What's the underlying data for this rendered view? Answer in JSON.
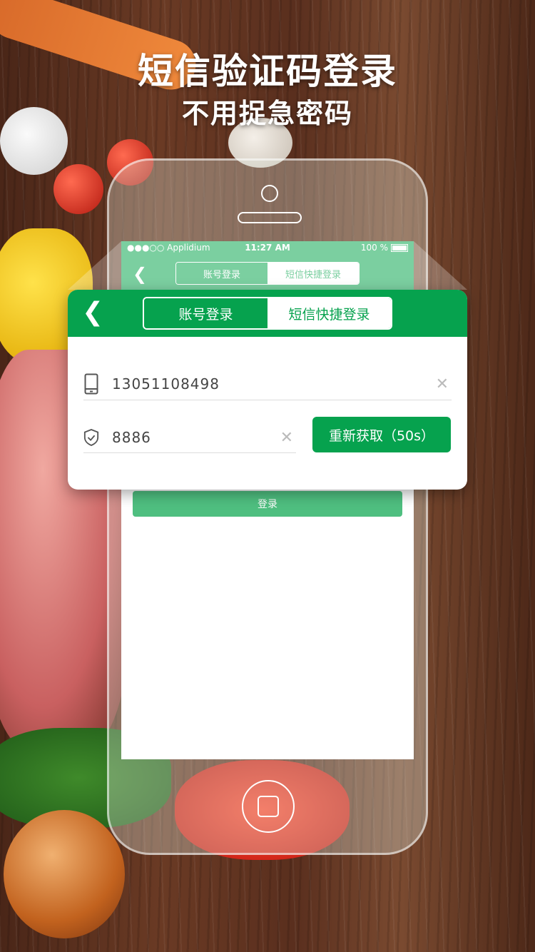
{
  "headline": {
    "title": "短信验证码登录",
    "subtitle": "不用捉急密码"
  },
  "phone_screen": {
    "status_bar": {
      "carrier": "●●●○○ Applidium",
      "time": "11:27 AM",
      "battery": "100 %"
    },
    "nav": {
      "tabs": [
        {
          "label": "账号登录",
          "state": "active"
        },
        {
          "label": "短信快捷登录",
          "state": "inactive"
        }
      ]
    },
    "login_button": "登录"
  },
  "card": {
    "tabs": [
      {
        "label": "账号登录",
        "state": "active"
      },
      {
        "label": "短信快捷登录",
        "state": "inactive"
      }
    ],
    "phone_field": {
      "value": "13051108498"
    },
    "code_field": {
      "value": "8886"
    },
    "resend_button": "重新获取（50s）"
  },
  "colors": {
    "brand_green": "#06a24e",
    "light_green": "#4fbf80",
    "white": "#ffffff"
  }
}
